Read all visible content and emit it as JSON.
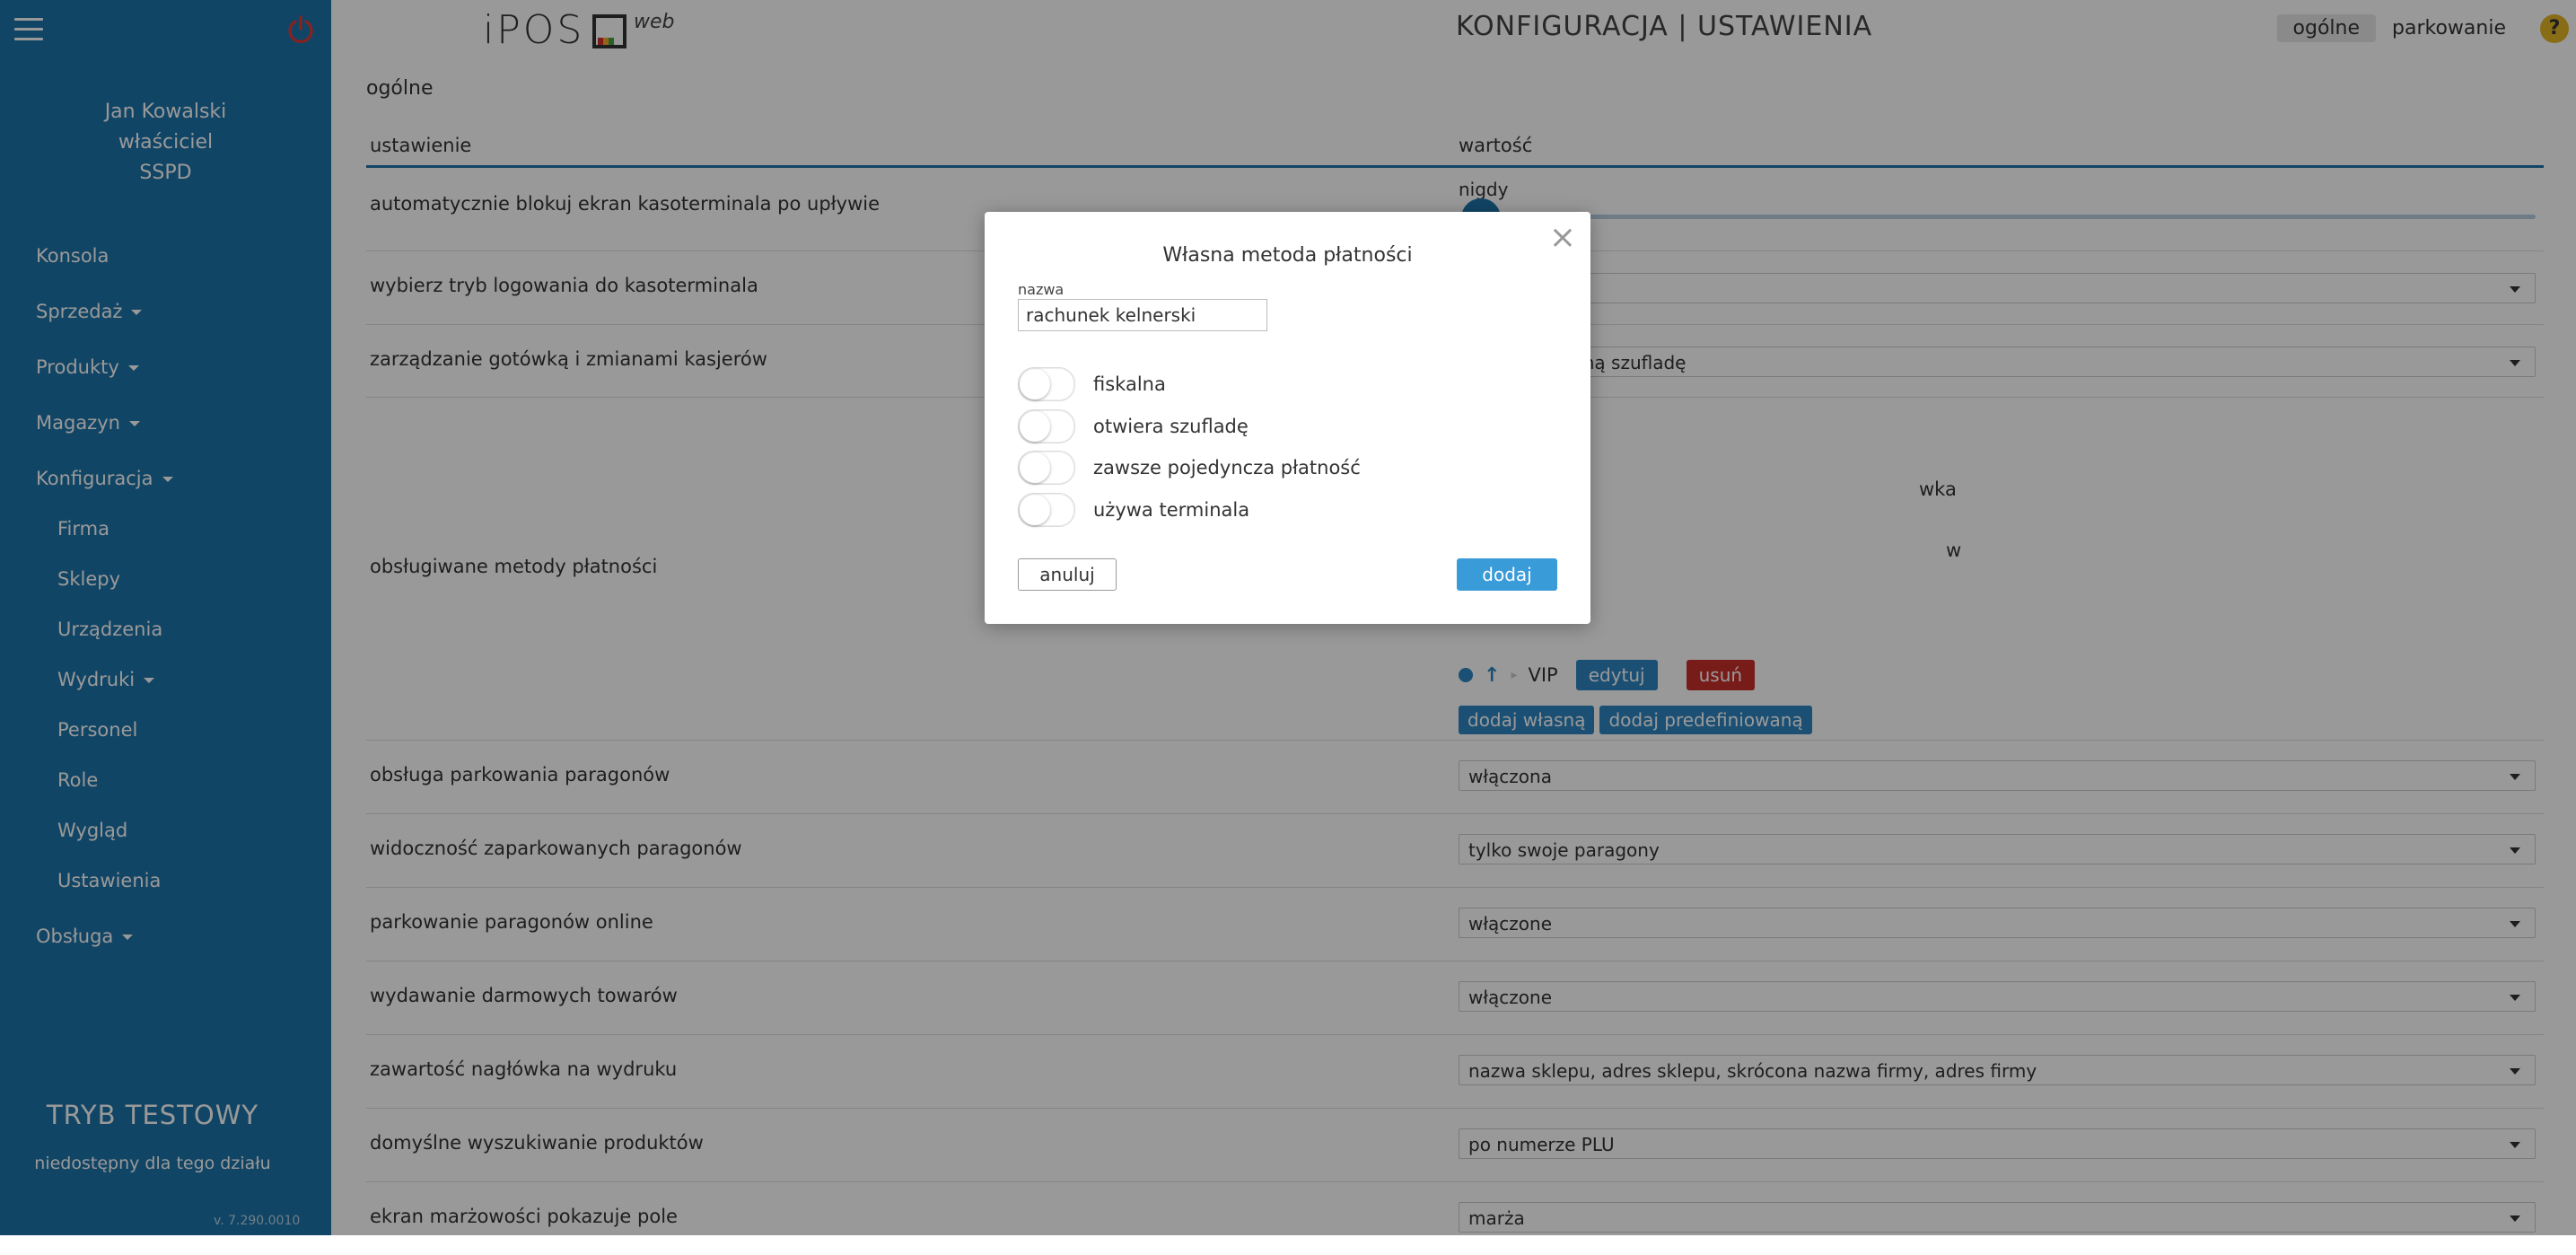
{
  "app": {
    "logo_text": "iPOS",
    "logo_suffix": "web",
    "page_title": "KONFIGURACJA | USTAWIENIA"
  },
  "header": {
    "links": [
      "ogólne",
      "parkowanie"
    ],
    "active_link": "ogólne",
    "help": "?"
  },
  "sidebar": {
    "user": {
      "name": "Jan Kowalski",
      "role": "właściciel",
      "company": "SSPD"
    },
    "items": [
      {
        "label": "Konsola",
        "caret": false
      },
      {
        "label": "Sprzedaż",
        "caret": true
      },
      {
        "label": "Produkty",
        "caret": true
      },
      {
        "label": "Magazyn",
        "caret": true
      },
      {
        "label": "Konfiguracja",
        "caret": true
      }
    ],
    "subitems": [
      {
        "label": "Firma"
      },
      {
        "label": "Sklepy"
      },
      {
        "label": "Urządzenia"
      },
      {
        "label": "Wydruki",
        "caret": true
      },
      {
        "label": "Personel"
      },
      {
        "label": "Role"
      },
      {
        "label": "Wygląd"
      },
      {
        "label": "Ustawienia"
      }
    ],
    "last_item": {
      "label": "Obsługa",
      "caret": true
    },
    "test_mode": "TRYB TESTOWY",
    "test_mode_sub": "niedostępny dla tego działu",
    "version": "v. 7.290.0010"
  },
  "content": {
    "section": "ogólne",
    "columns": {
      "setting": "ustawienie",
      "value": "wartość"
    },
    "rows": {
      "r1": {
        "label": "automatycznie blokuj ekran kasoterminala po upływie",
        "value": "nigdy"
      },
      "r2": {
        "label": "wybierz tryb logowania do kasoterminala",
        "value": ""
      },
      "r3": {
        "label": "zarządzanie gotówką i zmianami kasjerów",
        "value": "r mają wspólną szufladę"
      },
      "r4": {
        "label": "obsługiwane metody płatności",
        "partial1": "wka",
        "partial2": "w",
        "method": "VIP",
        "edit": "edytuj",
        "delete": "usuń",
        "add_own": "dodaj własną",
        "add_predef": "dodaj predefiniowaną"
      },
      "r5": {
        "label": "obsługa parkowania paragonów",
        "value": "włączona"
      },
      "r6": {
        "label": "widoczność zaparkowanych paragonów",
        "value": "tylko swoje paragony"
      },
      "r7": {
        "label": "parkowanie paragonów online",
        "value": "włączone"
      },
      "r8": {
        "label": "wydawanie darmowych towarów",
        "value": "włączone"
      },
      "r9": {
        "label": "zawartość nagłówka na wydruku",
        "value": "nazwa sklepu, adres sklepu, skrócona nazwa firmy, adres firmy"
      },
      "r10": {
        "label": "domyślne wyszukiwanie produktów",
        "value": "po numerze PLU"
      },
      "r11": {
        "label": "ekran marżowości pokazuje pole",
        "value": "marża"
      }
    }
  },
  "modal": {
    "title": "Własna metoda płatności",
    "name_label": "nazwa",
    "name_value": "rachunek kelnerski",
    "toggles": [
      {
        "label": "fiskalna",
        "on": false
      },
      {
        "label": "otwiera szufladę",
        "on": false
      },
      {
        "label": "zawsze pojedyncza płatność",
        "on": false
      },
      {
        "label": "używa terminala",
        "on": false
      }
    ],
    "cancel": "anuluj",
    "add": "dodaj",
    "close": "×"
  },
  "colors": {
    "sidebar": "#1d74a8",
    "primary": "#3a9bd9",
    "danger": "#c9302c",
    "help": "#e3b526"
  }
}
